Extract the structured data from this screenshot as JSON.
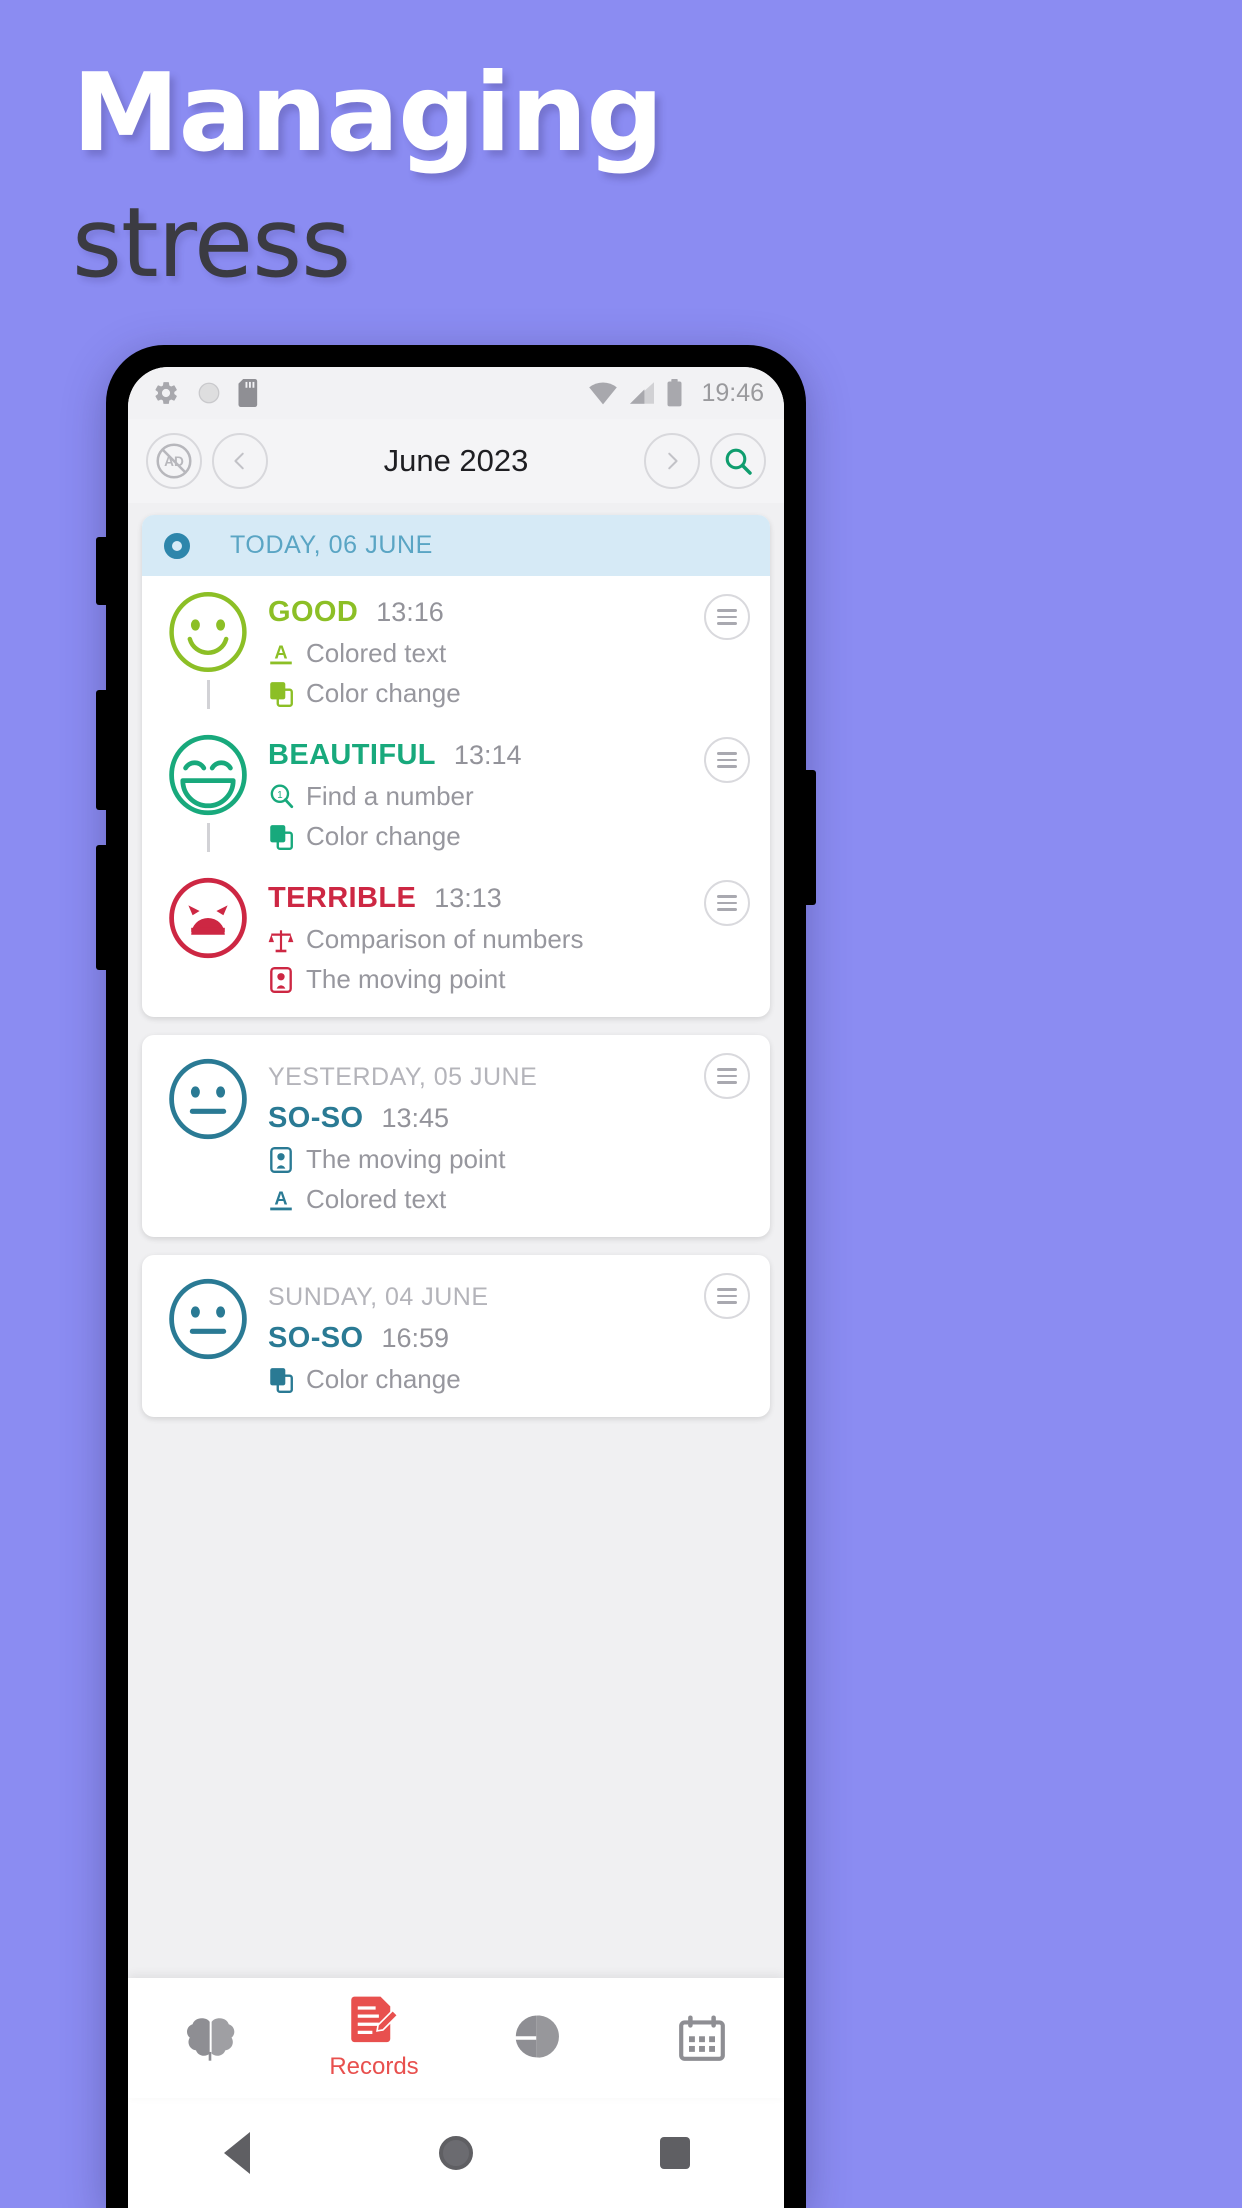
{
  "promo": {
    "line1": "Managing",
    "line2": "stress",
    "bg_color": "#8b8cf2",
    "line1_color": "#ffffff",
    "line2_color": "#3b3b42"
  },
  "status_bar": {
    "icons_left": [
      "gear-icon",
      "circle-icon",
      "sd-card-icon"
    ],
    "icons_right": [
      "wifi-icon",
      "signal-icon",
      "battery-icon"
    ],
    "time": "19:46"
  },
  "toolbar": {
    "ad_block_label": "AD",
    "prev_icon": "chevron-left-icon",
    "title": "June 2023",
    "next_icon": "chevron-right-icon",
    "search_icon": "search-icon",
    "search_color": "#0f9d6e"
  },
  "today_banner": {
    "label": "TODAY, 06 JUNE",
    "bg": "#d6eaf6",
    "text_color": "#5aa5c4",
    "ring_color": "#2e86ab"
  },
  "entries": [
    {
      "mood": "GOOD",
      "time": "13:16",
      "color": "#8cbf26",
      "face": "smile",
      "date_header": "",
      "tags": [
        {
          "icon": "colored-text-icon",
          "label": "Colored text"
        },
        {
          "icon": "color-change-icon",
          "label": "Color change"
        }
      ]
    },
    {
      "mood": "BEAUTIFUL",
      "time": "13:14",
      "color": "#18a97c",
      "face": "laugh",
      "date_header": "",
      "tags": [
        {
          "icon": "find-a-number-icon",
          "label": "Find a number"
        },
        {
          "icon": "color-change-icon",
          "label": "Color change"
        }
      ]
    },
    {
      "mood": "TERRIBLE",
      "time": "13:13",
      "color": "#cd2743",
      "face": "angry",
      "date_header": "",
      "tags": [
        {
          "icon": "comparison-of-numbers-icon",
          "label": "Comparison of numbers"
        },
        {
          "icon": "the-moving-point-icon",
          "label": "The moving point"
        }
      ]
    }
  ],
  "day_cards": [
    {
      "date_header": "YESTERDAY, 05 JUNE",
      "mood": "SO-SO",
      "time": "13:45",
      "color": "#2a7a94",
      "face": "neutral",
      "tags": [
        {
          "icon": "the-moving-point-icon",
          "label": "The moving point"
        },
        {
          "icon": "colored-text-icon",
          "label": "Colored text"
        }
      ]
    },
    {
      "date_header": "SUNDAY, 04 JUNE",
      "mood": "SO-SO",
      "time": "16:59",
      "color": "#2a7a94",
      "face": "neutral",
      "tags": [
        {
          "icon": "color-change-icon",
          "label": "Color change"
        }
      ]
    }
  ],
  "bottom_nav": {
    "items": [
      {
        "icon": "brain-icon",
        "label": "",
        "active": false
      },
      {
        "icon": "records-icon",
        "label": "Records",
        "active": true
      },
      {
        "icon": "pie-chart-icon",
        "label": "",
        "active": false
      },
      {
        "icon": "calendar-icon",
        "label": "",
        "active": false
      }
    ],
    "active_color": "#e8504e",
    "inactive_color": "#8e8e93"
  },
  "android_nav": {
    "back": "back-triangle-icon",
    "home": "home-circle-icon",
    "recents": "recents-square-icon"
  }
}
